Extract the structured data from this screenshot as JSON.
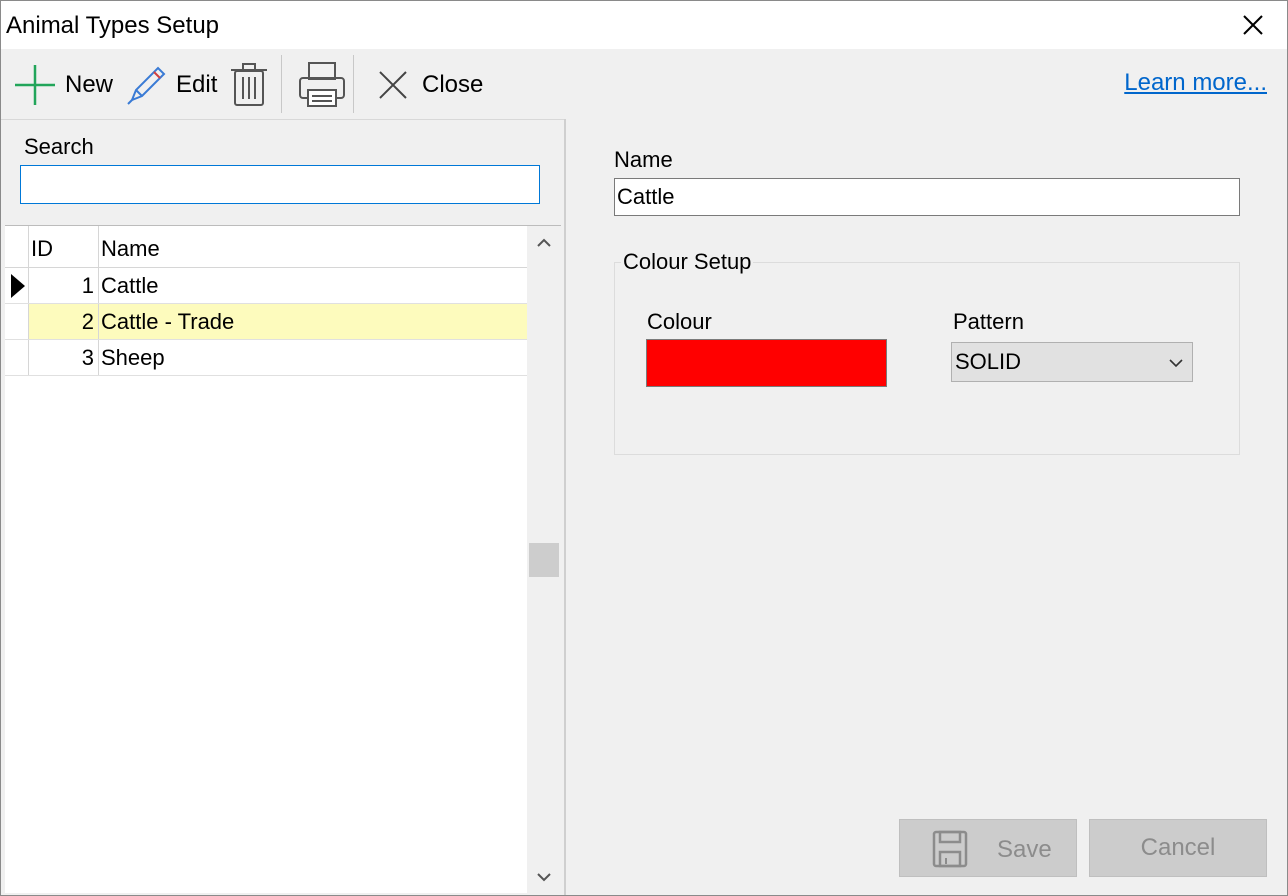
{
  "window": {
    "title": "Animal Types Setup"
  },
  "toolbar": {
    "new_label": "New",
    "edit_label": "Edit",
    "close_label": "Close",
    "learn_more": "Learn more..."
  },
  "search": {
    "label": "Search",
    "value": ""
  },
  "grid": {
    "columns": [
      "ID",
      "Name"
    ],
    "rows": [
      {
        "id": "1",
        "name": "Cattle"
      },
      {
        "id": "2",
        "name": "Cattle - Trade"
      },
      {
        "id": "3",
        "name": "Sheep"
      }
    ]
  },
  "detail": {
    "name_label": "Name",
    "name_value": "Cattle",
    "group_title": "Colour Setup",
    "colour_label": "Colour",
    "colour_value": "#ff0000",
    "pattern_label": "Pattern",
    "pattern_value": "SOLID"
  },
  "actions": {
    "save_label": "Save",
    "cancel_label": "Cancel"
  },
  "colors": {
    "accent_link": "#0066cc",
    "highlight_row": "#fdfbbd",
    "new_icon": "#22a55a"
  },
  "icons": {
    "new": "plus-icon",
    "edit": "pencil-icon",
    "delete": "trash-icon",
    "print": "printer-icon",
    "close": "close-icon",
    "save": "floppy-disk-icon"
  }
}
